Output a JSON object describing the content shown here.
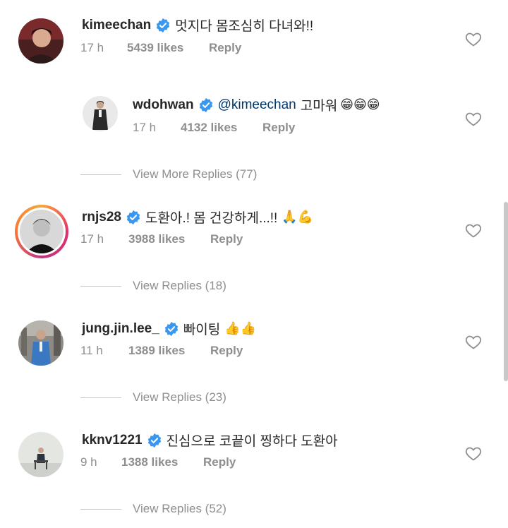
{
  "comments": [
    {
      "username": "kimeechan",
      "text": "멋지다 몸조심히 다녀와!!",
      "time": "17 h",
      "likes": "5439 likes",
      "reply": "Reply"
    },
    {
      "username": "wdohwan",
      "mention": "@kimeechan",
      "text": "고마워",
      "emoji": "😁😁😁",
      "time": "17 h",
      "likes": "4132 likes",
      "reply": "Reply",
      "view_replies": "View More Replies (77)"
    },
    {
      "username": "rnjs28",
      "text": "도환아.! 몸 건강하게...!!",
      "emoji": "🙏💪",
      "time": "17 h",
      "likes": "3988 likes",
      "reply": "Reply",
      "view_replies": "View Replies (18)"
    },
    {
      "username": "jung.jin.lee_",
      "text": "빠이팅",
      "emoji": "👍👍",
      "time": "11 h",
      "likes": "1389 likes",
      "reply": "Reply",
      "view_replies": "View Replies (23)"
    },
    {
      "username": "kknv1221",
      "text": "진심으로 코끝이 찡하다 도환아",
      "time": "9 h",
      "likes": "1388 likes",
      "reply": "Reply",
      "view_replies": "View Replies (52)"
    }
  ],
  "colors": {
    "verified": "#3897f0",
    "mention": "#00376b",
    "muted": "#8e8e8e"
  },
  "icons": [
    "verified-badge-icon",
    "heart-outline-icon"
  ]
}
